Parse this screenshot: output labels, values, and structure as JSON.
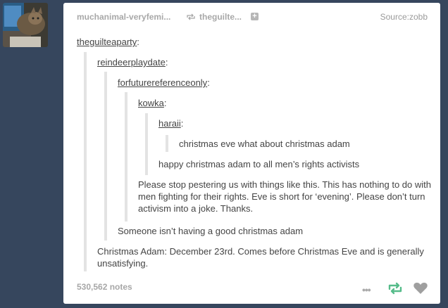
{
  "header": {
    "reblogger": "muchanimal-veryfemi...",
    "reblogged_from": "theguilte...",
    "plus": "+",
    "source": "Source:zobb"
  },
  "thread": {
    "u1": "theguilteaparty",
    "u2": "reindeerplaydate",
    "u3": "forfuturereferenceonly",
    "u4": "kowka",
    "u5": "haraii",
    "colon": ":",
    "t5": "christmas eve what about christmas adam",
    "t4": "happy christmas adam to all men’s rights activists",
    "t3": "Please stop pestering us with things like this. This has nothing to do with men fighting for their rights. Eve is short for ‘evening’. Please don’t turn activism into a joke. Thanks.",
    "t2": "Someone isn’t having a good christmas adam",
    "t1": "Christmas Adam: December 23rd. Comes before Christmas Eve and is generally unsatisfying."
  },
  "footer": {
    "notes": "530,562 notes",
    "more": "•••"
  },
  "colors": {
    "background": "#36465d",
    "reblog_green": "#56bc8a",
    "heart_gray": "#9f9f9f"
  }
}
